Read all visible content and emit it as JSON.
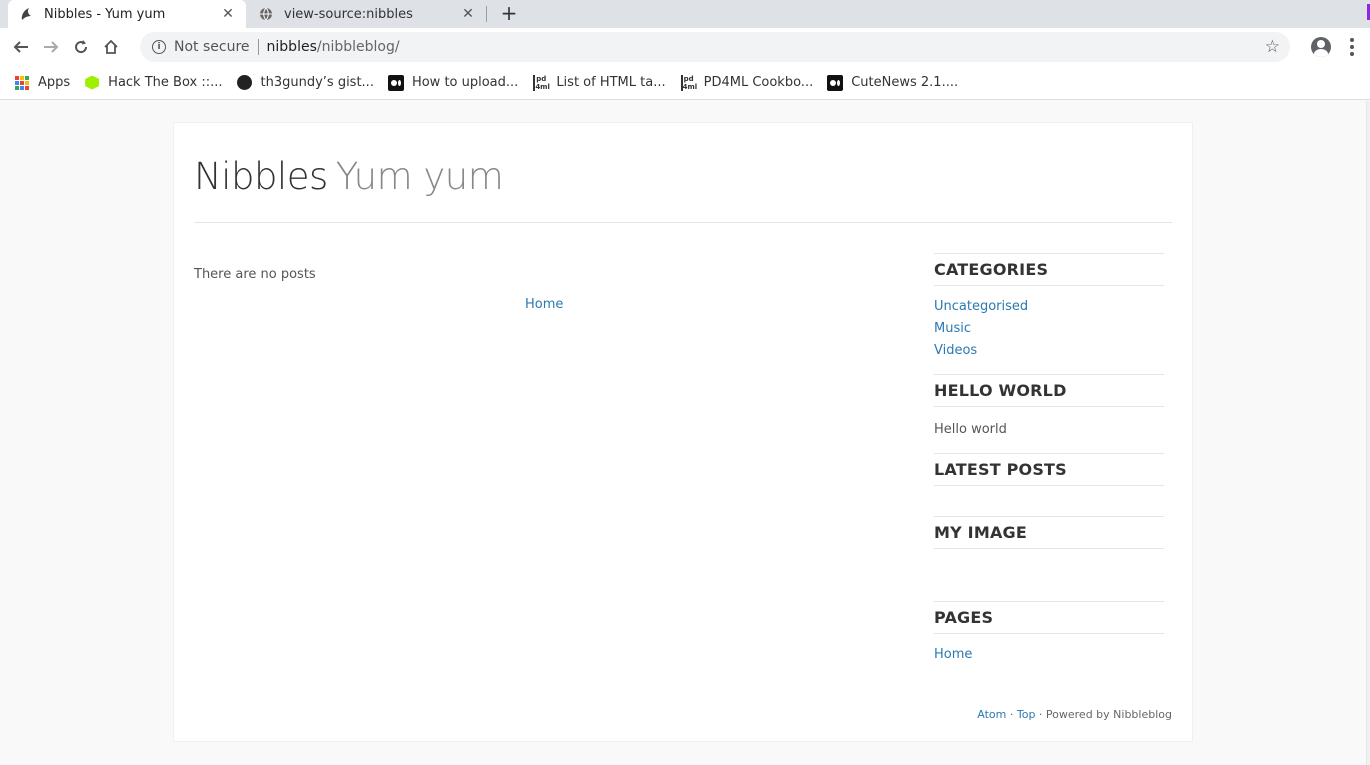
{
  "browser": {
    "tabs": [
      {
        "title": "Nibbles - Yum yum",
        "active": true
      },
      {
        "title": "view-source:nibbles",
        "active": false
      }
    ],
    "omnibox": {
      "security": "Not secure",
      "host": "nibbles",
      "path": "/nibbleblog/"
    },
    "bookmarks": [
      {
        "label": "Apps",
        "icon": "apps-grid-icon"
      },
      {
        "label": "Hack The Box ::...",
        "icon": "hackthebox-icon"
      },
      {
        "label": "th3gundy’s gist...",
        "icon": "github-icon"
      },
      {
        "label": "How to upload...",
        "icon": "medium-icon"
      },
      {
        "label": "List of HTML ta...",
        "icon": "pd4ml-icon"
      },
      {
        "label": "PD4ML Cookbo...",
        "icon": "pd4ml-icon"
      },
      {
        "label": "CuteNews 2.1....",
        "icon": "medium-icon"
      }
    ]
  },
  "site": {
    "name": "Nibbles",
    "slogan": "Yum yum",
    "no_posts": "There are no posts",
    "pager_home": "Home"
  },
  "sidebar": {
    "categories": {
      "title": "CATEGORIES",
      "items": [
        "Uncategorised",
        "Music",
        "Videos"
      ]
    },
    "hello": {
      "title": "HELLO WORLD",
      "text": "Hello world"
    },
    "latest": {
      "title": "LATEST POSTS"
    },
    "image": {
      "title": "MY IMAGE"
    },
    "pages": {
      "title": "PAGES",
      "items": [
        "Home"
      ]
    }
  },
  "footer": {
    "atom": "Atom",
    "sep1": " · ",
    "top": "Top",
    "powered": " · Powered by Nibbleblog"
  },
  "colors": {
    "link": "#2a7ab0",
    "htb_green": "#9fef00"
  }
}
